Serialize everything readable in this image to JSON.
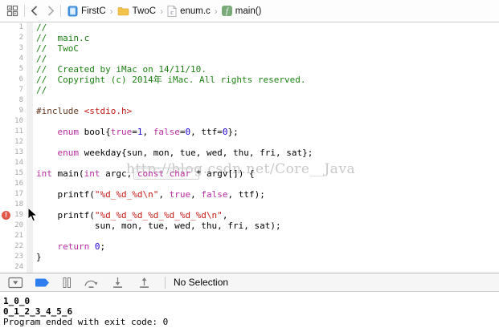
{
  "jump_bar": {
    "related_items_icon": "related-items-icon",
    "back_icon": "back-chevron-icon",
    "forward_icon": "forward-chevron-icon",
    "items": [
      {
        "label": "FirstC",
        "icon": "project-icon"
      },
      {
        "label": "TwoC",
        "icon": "folder-icon"
      },
      {
        "label": "enum.c",
        "icon": "c-file-icon"
      },
      {
        "label": "main()",
        "icon": "function-icon"
      }
    ]
  },
  "editor": {
    "colors": {
      "comment": "#1e8015",
      "keyword": "#ba2da2",
      "number": "#1c00cf",
      "string": "#c41a16",
      "preprocessor": "#643820",
      "plain": "#000000"
    },
    "watermark": "http://blog.csdn.net/Core__Java",
    "error_badge": {
      "line": 19,
      "symbol": "!",
      "color": "#e2574c"
    },
    "lines": [
      {
        "n": 1,
        "segs": [
          [
            "comment",
            "//"
          ]
        ]
      },
      {
        "n": 2,
        "segs": [
          [
            "comment",
            "//  main.c"
          ]
        ]
      },
      {
        "n": 3,
        "segs": [
          [
            "comment",
            "//  TwoC"
          ]
        ]
      },
      {
        "n": 4,
        "segs": [
          [
            "comment",
            "//"
          ]
        ]
      },
      {
        "n": 5,
        "segs": [
          [
            "comment",
            "//  Created by iMac on 14/11/10."
          ]
        ]
      },
      {
        "n": 6,
        "segs": [
          [
            "comment",
            "//  Copyright (c) 2014年 iMac. All rights reserved."
          ]
        ]
      },
      {
        "n": 7,
        "segs": [
          [
            "comment",
            "//"
          ]
        ]
      },
      {
        "n": 8,
        "segs": []
      },
      {
        "n": 9,
        "segs": [
          [
            "preprocessor",
            "#include "
          ],
          [
            "string",
            "<stdio.h>"
          ]
        ]
      },
      {
        "n": 10,
        "segs": []
      },
      {
        "n": 11,
        "segs": [
          [
            "plain",
            "    "
          ],
          [
            "keyword",
            "enum"
          ],
          [
            "plain",
            " bool{"
          ],
          [
            "keyword",
            "true"
          ],
          [
            "plain",
            "="
          ],
          [
            "number",
            "1"
          ],
          [
            "plain",
            ", "
          ],
          [
            "keyword",
            "false"
          ],
          [
            "plain",
            "="
          ],
          [
            "number",
            "0"
          ],
          [
            "plain",
            ", ttf="
          ],
          [
            "number",
            "0"
          ],
          [
            "plain",
            "};"
          ]
        ]
      },
      {
        "n": 12,
        "segs": []
      },
      {
        "n": 13,
        "segs": [
          [
            "plain",
            "    "
          ],
          [
            "keyword",
            "enum"
          ],
          [
            "plain",
            " weekday{sun, mon, tue, wed, thu, fri, sat};"
          ]
        ]
      },
      {
        "n": 14,
        "segs": []
      },
      {
        "n": 15,
        "segs": [
          [
            "keyword",
            "int"
          ],
          [
            "plain",
            " main("
          ],
          [
            "keyword",
            "int"
          ],
          [
            "plain",
            " argc, "
          ],
          [
            "keyword",
            "const"
          ],
          [
            "plain",
            " "
          ],
          [
            "keyword",
            "char"
          ],
          [
            "plain",
            " * argv[]) {"
          ]
        ]
      },
      {
        "n": 16,
        "segs": []
      },
      {
        "n": 17,
        "segs": [
          [
            "plain",
            "    printf("
          ],
          [
            "string",
            "\"%d_%d_%d\\n\""
          ],
          [
            "plain",
            ", "
          ],
          [
            "keyword",
            "true"
          ],
          [
            "plain",
            ", "
          ],
          [
            "keyword",
            "false"
          ],
          [
            "plain",
            ", ttf);"
          ]
        ]
      },
      {
        "n": 18,
        "segs": []
      },
      {
        "n": 19,
        "segs": [
          [
            "plain",
            "    printf("
          ],
          [
            "string",
            "\"%d_%d_%d_%d_%d_%d_%d\\n\""
          ],
          [
            "plain",
            ","
          ]
        ]
      },
      {
        "n": 20,
        "segs": [
          [
            "plain",
            "           sun, mon, tue, wed, thu, fri, sat);"
          ]
        ]
      },
      {
        "n": 21,
        "segs": []
      },
      {
        "n": 22,
        "segs": [
          [
            "plain",
            "    "
          ],
          [
            "keyword",
            "return"
          ],
          [
            "plain",
            " "
          ],
          [
            "number",
            "0"
          ],
          [
            "plain",
            ";"
          ]
        ]
      },
      {
        "n": 23,
        "segs": [
          [
            "plain",
            "}"
          ]
        ]
      },
      {
        "n": 24,
        "segs": []
      }
    ]
  },
  "debug_bar": {
    "buttons": [
      {
        "name": "hide-debug-area-button",
        "icon": "hide-debug-area-icon"
      },
      {
        "name": "breakpoints-toggle-button",
        "icon": "breakpoint-arrow-icon",
        "accent": "#2d7ff0"
      },
      {
        "name": "pause-button",
        "icon": "pause-icon"
      },
      {
        "name": "step-over-button",
        "icon": "step-over-icon"
      },
      {
        "name": "step-into-button",
        "icon": "step-into-icon"
      },
      {
        "name": "step-out-button",
        "icon": "step-out-icon"
      }
    ],
    "status": "No Selection"
  },
  "console": {
    "lines": [
      {
        "text": "1_0_0",
        "bold": true
      },
      {
        "text": "0_1_2_3_4_5_6",
        "bold": true
      },
      {
        "text": "Program ended with exit code: 0",
        "bold": false
      }
    ]
  }
}
